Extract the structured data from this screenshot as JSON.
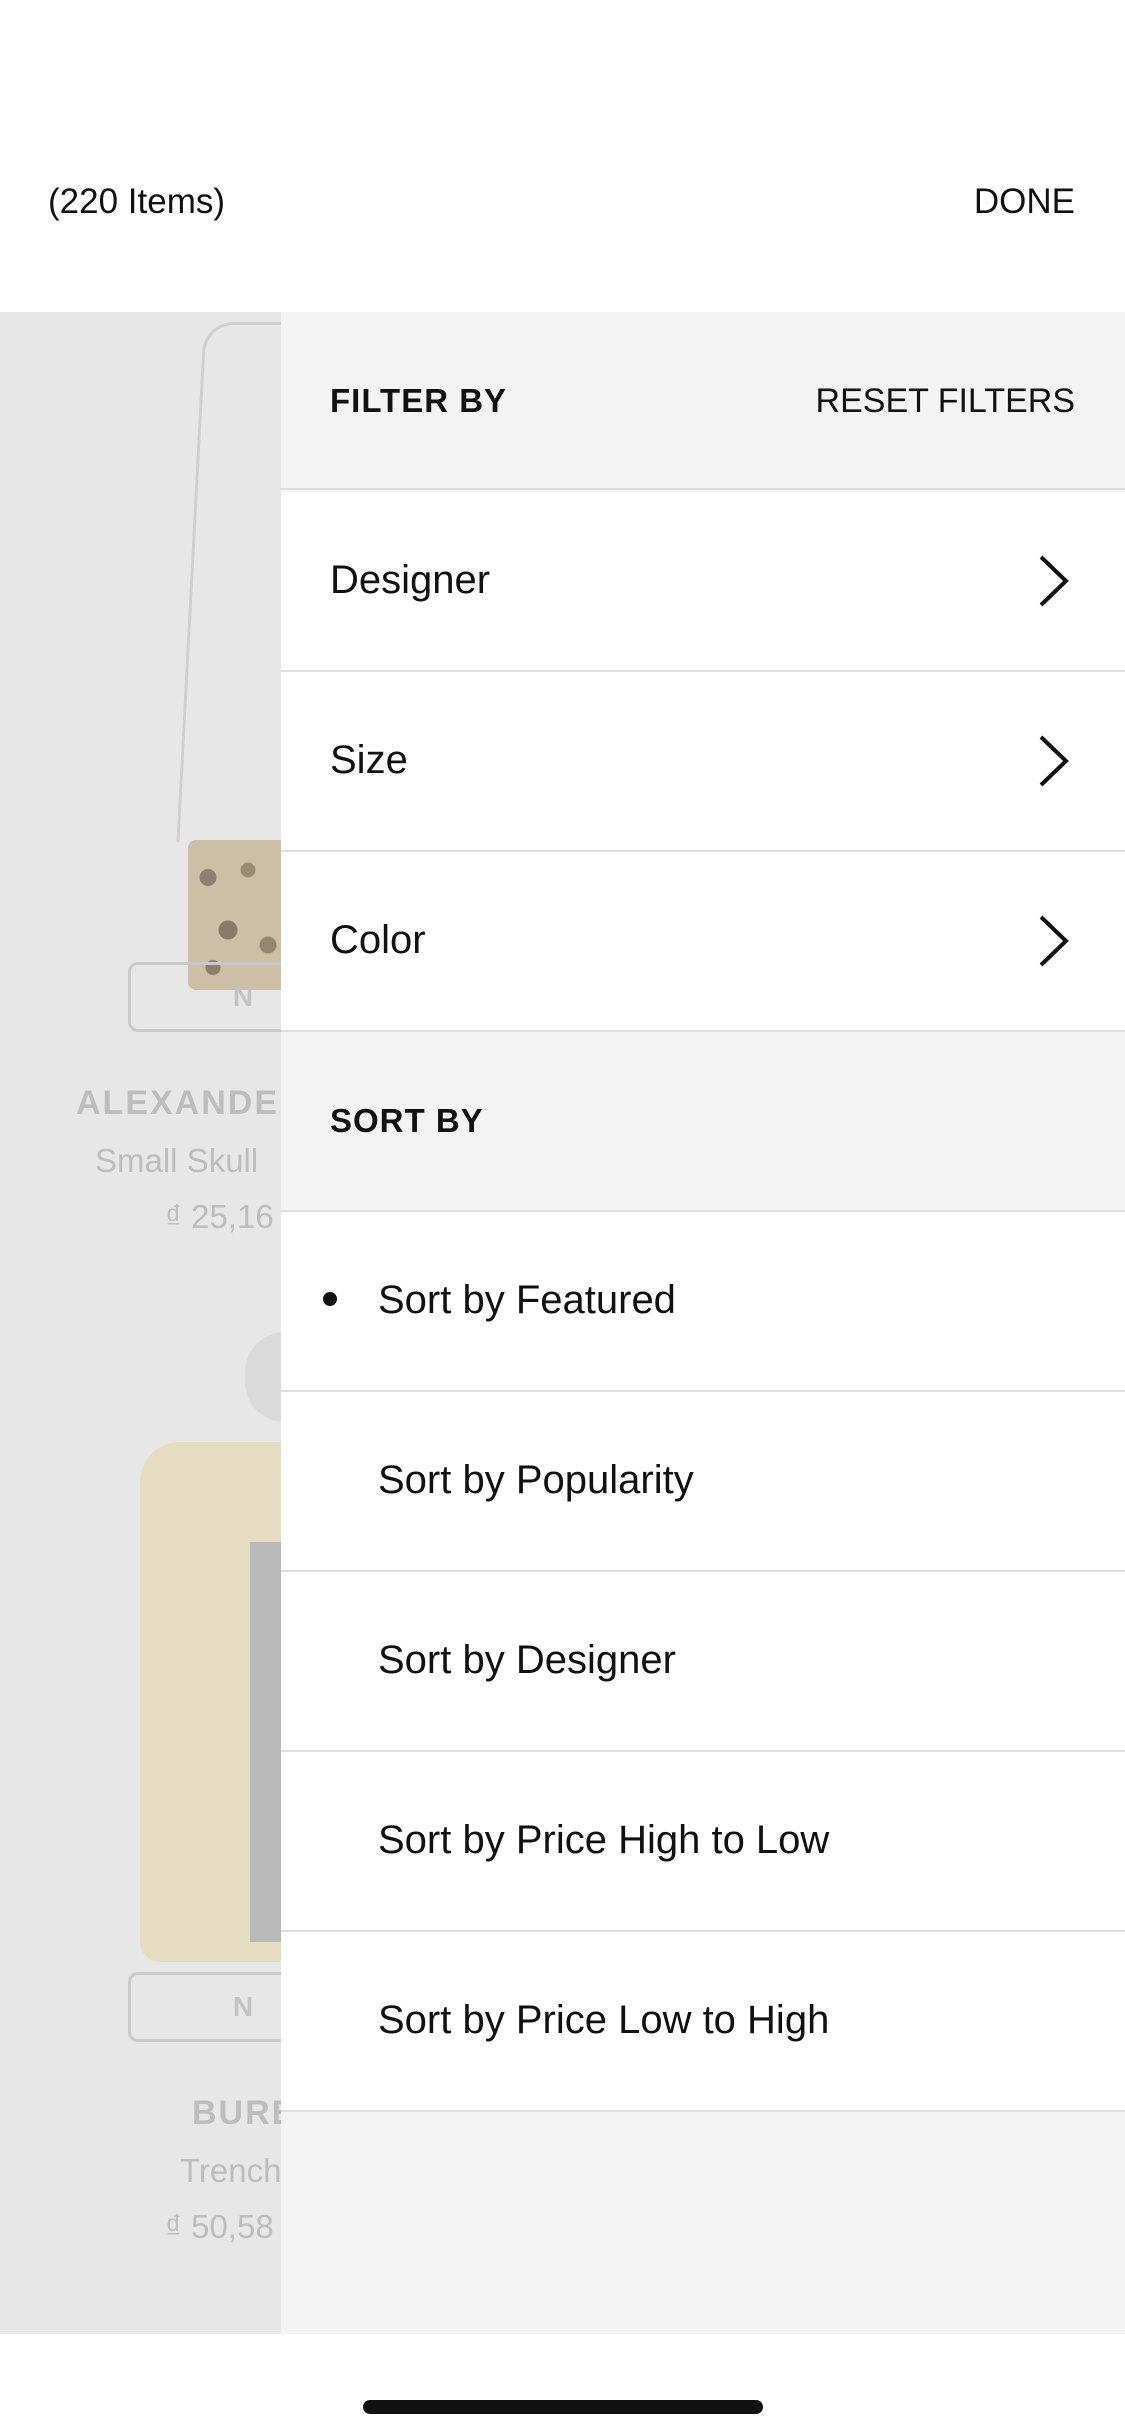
{
  "header": {
    "items_count": "(220 Items)",
    "done_label": "DONE"
  },
  "background_products": [
    {
      "badge": "N",
      "brand": "ALEXANDE",
      "name": "Small Skull",
      "price": "₫ 25,16"
    },
    {
      "badge": "N",
      "brand": "BURE",
      "name": "Trench",
      "price": "₫ 50,58"
    }
  ],
  "filter": {
    "title": "FILTER BY",
    "reset_label": "RESET FILTERS",
    "items": [
      {
        "label": "Designer",
        "icon": "chevron-right-icon"
      },
      {
        "label": "Size",
        "icon": "chevron-right-icon"
      },
      {
        "label": "Color",
        "icon": "chevron-right-icon"
      }
    ]
  },
  "sort": {
    "title": "SORT BY",
    "selected_index": 0,
    "options": [
      {
        "label": "Sort by Featured"
      },
      {
        "label": "Sort by Popularity"
      },
      {
        "label": "Sort by Designer"
      },
      {
        "label": "Sort by Price High to Low"
      },
      {
        "label": "Sort by Price Low to High"
      }
    ]
  }
}
